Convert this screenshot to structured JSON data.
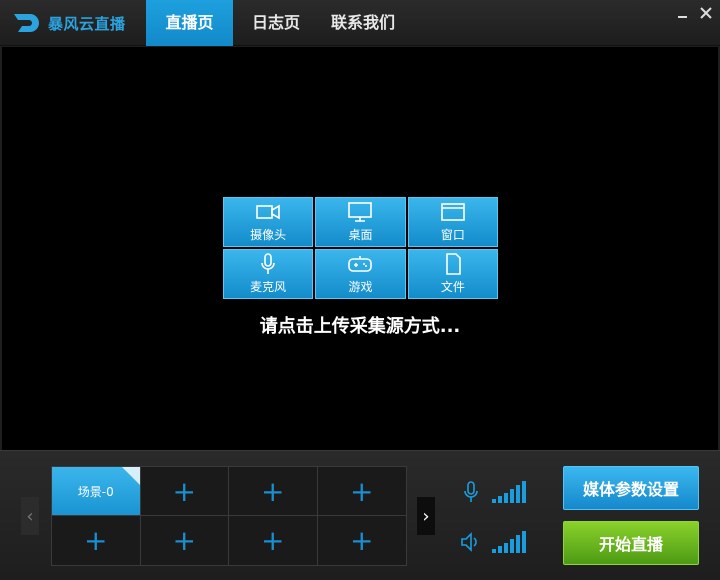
{
  "app": {
    "name": "暴风云直播"
  },
  "tabs": [
    {
      "label": "直播页",
      "active": true
    },
    {
      "label": "日志页",
      "active": false
    },
    {
      "label": "联系我们",
      "active": false
    }
  ],
  "window_controls": {
    "minimize": "minimize-icon",
    "close": "close-icon"
  },
  "sources": [
    {
      "label": "摄像头",
      "icon": "camera-icon"
    },
    {
      "label": "桌面",
      "icon": "monitor-icon"
    },
    {
      "label": "窗口",
      "icon": "window-icon"
    },
    {
      "label": "麦克风",
      "icon": "microphone-icon"
    },
    {
      "label": "游戏",
      "icon": "gamepad-icon"
    },
    {
      "label": "文件",
      "icon": "file-icon"
    }
  ],
  "prompt": "请点击上传采集源方式...",
  "scenes": [
    {
      "label": "场景-0",
      "active": true
    },
    {
      "label": "+"
    },
    {
      "label": "+"
    },
    {
      "label": "+"
    },
    {
      "label": "+"
    },
    {
      "label": "+"
    },
    {
      "label": "+"
    },
    {
      "label": "+"
    }
  ],
  "meters": {
    "mic_icon": "microphone-icon",
    "speaker_icon": "speaker-icon",
    "levels": [
      1,
      2,
      3,
      4,
      5,
      6
    ]
  },
  "actions": {
    "media_settings": "媒体参数设置",
    "start_live": "开始直播"
  },
  "colors": {
    "accent_blue": "#1a9ddf",
    "start_green": "#5fae19"
  }
}
